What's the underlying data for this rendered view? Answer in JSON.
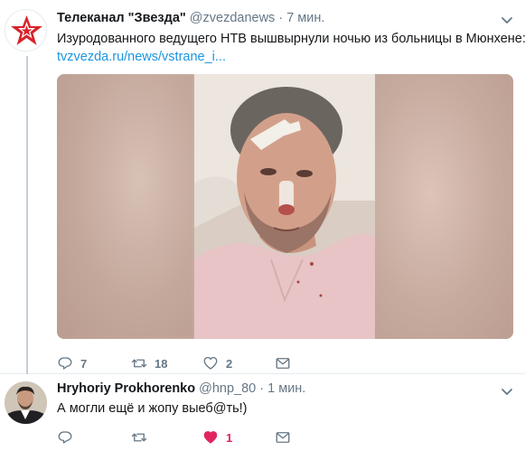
{
  "tweets": [
    {
      "author_name": "Телеканал \"Звезда\"",
      "handle": "@zvezdanews",
      "separator": "·",
      "time": "7 мин.",
      "text": "Изуродованного ведущего НТВ вышвырнули ночью из больницы в Мюнхене:",
      "link": "tvzvezda.ru/news/vstrane_i...",
      "actions": {
        "reply_count": "7",
        "retweet_count": "18",
        "like_count": "2"
      }
    },
    {
      "author_name": "Hryhoriy Prokhorenko",
      "handle": "@hnp_80",
      "separator": "·",
      "time": "1 мин.",
      "text": "А могли ещё и жопу выеб@ть!)",
      "actions": {
        "like_count": "1",
        "liked": true
      }
    }
  ],
  "colors": {
    "accent": "#1b95e0",
    "like": "#e0245e",
    "muted": "#657786",
    "logo_red": "#d8232a"
  }
}
